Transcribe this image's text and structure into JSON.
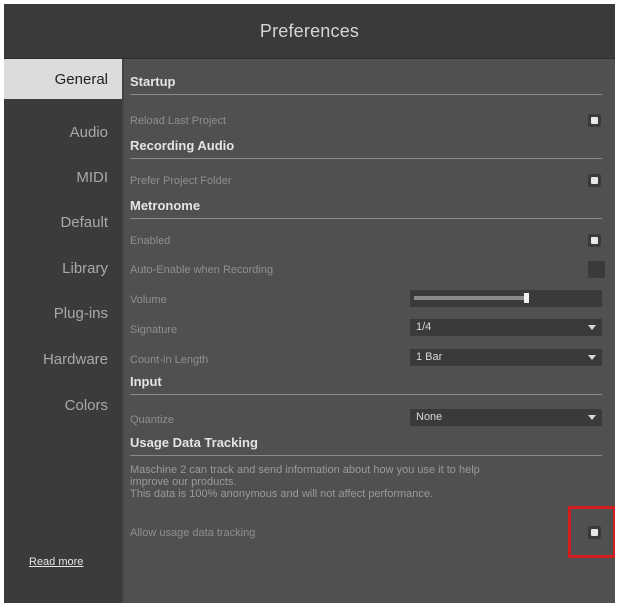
{
  "window": {
    "title": "Preferences"
  },
  "sidebar": {
    "items": [
      {
        "label": "General",
        "active": true
      },
      {
        "label": "Audio"
      },
      {
        "label": "MIDI"
      },
      {
        "label": "Default"
      },
      {
        "label": "Library"
      },
      {
        "label": "Plug-ins"
      },
      {
        "label": "Hardware"
      },
      {
        "label": "Colors"
      }
    ]
  },
  "sections": {
    "startup": {
      "title": "Startup",
      "reload_last_project": {
        "label": "Reload Last Project",
        "checked": true
      }
    },
    "recording_audio": {
      "title": "Recording Audio",
      "prefer_project_folder": {
        "label": "Prefer Project Folder",
        "checked": true
      }
    },
    "metronome": {
      "title": "Metronome",
      "enabled": {
        "label": "Enabled",
        "checked": true
      },
      "auto_enable": {
        "label": "Auto-Enable when Recording",
        "checked": false
      },
      "volume": {
        "label": "Volume",
        "level": 0.6
      },
      "signature": {
        "label": "Signature",
        "value": "1/4"
      },
      "count_in": {
        "label": "Count-in Length",
        "value": "1 Bar"
      }
    },
    "input": {
      "title": "Input",
      "quantize": {
        "label": "Quantize",
        "value": "None"
      }
    },
    "usage": {
      "title": "Usage Data Tracking",
      "line1": "Maschine 2 can track and send information about how you use it to help",
      "line2": "improve our products.",
      "line3": "This data is 100% anonymous and will not affect performance.",
      "allow": {
        "label": "Allow usage data tracking",
        "checked": true
      },
      "read_more": "Read more"
    }
  },
  "colors": {
    "highlight": "#d11f1f",
    "active_tab": "#dcdcdc"
  }
}
